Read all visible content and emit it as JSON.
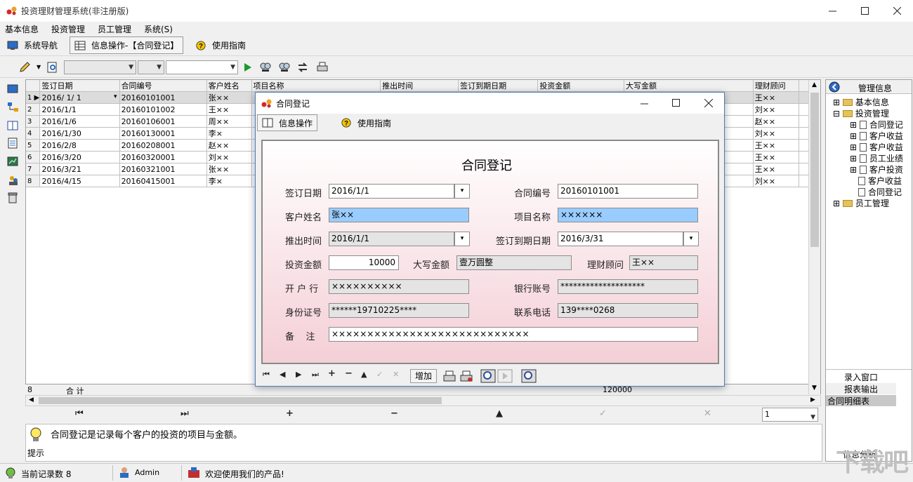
{
  "window": {
    "title": "投资理财管理系统(非注册版)"
  },
  "menu": [
    "基本信息",
    "投资管理",
    "员工管理",
    "系统(S)"
  ],
  "nav_tabs": [
    "系统导航",
    "信息操作-【合同登记】",
    "使用指南"
  ],
  "grid": {
    "columns": [
      "签订日期",
      "合同编号",
      "客户姓名",
      "项目名称",
      "推出时间",
      "签订到期日期",
      "投资金额",
      "大写金额",
      "理财顾问"
    ],
    "rows": [
      {
        "n": "1",
        "date": "2016/ 1/ 1",
        "id": "20160101001",
        "name": "张××",
        "adv": "王××"
      },
      {
        "n": "2",
        "date": "2016/1/1",
        "id": "20160101002",
        "name": "王××",
        "adv": "刘××"
      },
      {
        "n": "3",
        "date": "2016/1/6",
        "id": "20160106001",
        "name": "周××",
        "adv": "赵××"
      },
      {
        "n": "4",
        "date": "2016/1/30",
        "id": "20160130001",
        "name": "李×",
        "adv": "刘××"
      },
      {
        "n": "5",
        "date": "2016/2/8",
        "id": "20160208001",
        "name": "赵××",
        "adv": "王××"
      },
      {
        "n": "6",
        "date": "2016/3/20",
        "id": "20160320001",
        "name": "刘××",
        "adv": "王××"
      },
      {
        "n": "7",
        "date": "2016/3/21",
        "id": "20160321001",
        "name": "张××",
        "adv": "王××"
      },
      {
        "n": "8",
        "date": "2016/4/15",
        "id": "20160415001",
        "name": "李×",
        "adv": "刘××"
      }
    ],
    "footer": {
      "count": "8",
      "label": "合  计",
      "total": "120000"
    },
    "page_value": "1"
  },
  "hint": {
    "text": "合同登记是记录每个客户的投资的项目与金额。",
    "label": "提示"
  },
  "right_panel": {
    "header": "管理信息",
    "tree": [
      {
        "label": "基本信息",
        "level": 0
      },
      {
        "label": "投资管理",
        "level": 0
      },
      {
        "label": "合同登记",
        "level": 1
      },
      {
        "label": "客户收益",
        "level": 1
      },
      {
        "label": "客户收益",
        "level": 1
      },
      {
        "label": "员工业绩",
        "level": 1
      },
      {
        "label": "客户投资",
        "level": 1
      },
      {
        "label": "客户收益",
        "level": 1
      },
      {
        "label": "合同登记",
        "level": 1
      },
      {
        "label": "员工管理",
        "level": 0
      }
    ],
    "buttons": [
      "录入窗口",
      "报表输出",
      "合同明细表"
    ],
    "bottom": "信息分析"
  },
  "status": {
    "records": "当前记录数 8",
    "user": "Admin",
    "welcome": "欢迎使用我们的产品!"
  },
  "dialog": {
    "title": "合同登记",
    "tabs": [
      "信息操作",
      "使用指南"
    ],
    "heading": "合同登记",
    "labels": {
      "sign_date": "签订日期",
      "contract_no": "合同编号",
      "customer": "客户姓名",
      "project": "项目名称",
      "launch": "推出时间",
      "expire": "签订到期日期",
      "amount": "投资金额",
      "amount_cn": "大写金额",
      "advisor": "理财顾问",
      "bank": "开 户 行",
      "account": "银行账号",
      "idcard": "身份证号",
      "phone": "联系电话",
      "remark": "备    注"
    },
    "values": {
      "sign_date": "2016/1/1",
      "contract_no": "20160101001",
      "customer": "张××",
      "project": "××××××",
      "launch": "2016/1/1",
      "expire": "2016/3/31",
      "amount": "10000",
      "amount_cn": "壹万圆整",
      "advisor": "王××",
      "bank": "××××××××××",
      "account": "********************",
      "idcard": "******19710225****",
      "phone": "139****0268",
      "remark": "××××××××××××××××××××××××××××"
    },
    "add_button": "增加"
  },
  "watermark": "下载吧"
}
